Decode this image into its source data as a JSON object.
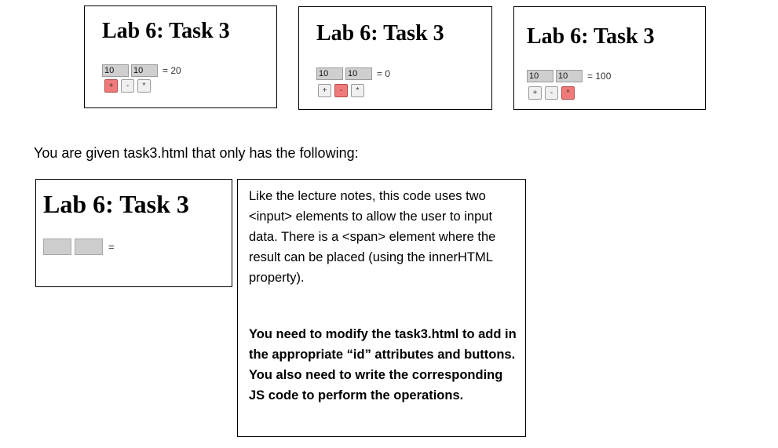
{
  "examples": [
    {
      "title": "Lab 6: Task 3",
      "input_a": "10",
      "input_b": "10",
      "result": "= 20",
      "buttons": [
        {
          "label": "+",
          "active": true
        },
        {
          "label": "-",
          "active": false
        },
        {
          "label": "*",
          "active": false
        }
      ]
    },
    {
      "title": "Lab 6: Task 3",
      "input_a": "10",
      "input_b": "10",
      "result": "= 0",
      "buttons": [
        {
          "label": "+",
          "active": false
        },
        {
          "label": "-",
          "active": true
        },
        {
          "label": "*",
          "active": false
        }
      ]
    },
    {
      "title": "Lab 6: Task 3",
      "input_a": "10",
      "input_b": "10",
      "result": "= 100",
      "buttons": [
        {
          "label": "+",
          "active": false
        },
        {
          "label": "-",
          "active": false
        },
        {
          "label": "*",
          "active": true
        }
      ]
    }
  ],
  "intro": "You are given task3.html that only has the following:",
  "given": {
    "title": "Lab 6: Task 3",
    "equals": "="
  },
  "note": {
    "text": "Like the lecture notes, this code uses two <input> elements to allow the user to input data.  There is a <span> element where the result can be placed (using the innerHTML property).",
    "instruction": "You need to modify the task3.html to add in the appropriate “id” attributes and buttons.  You also need to write the corresponding JS code to perform the operations."
  },
  "colors": {
    "active_button": "#f07a7a",
    "input_bg": "#cfcfcf"
  }
}
